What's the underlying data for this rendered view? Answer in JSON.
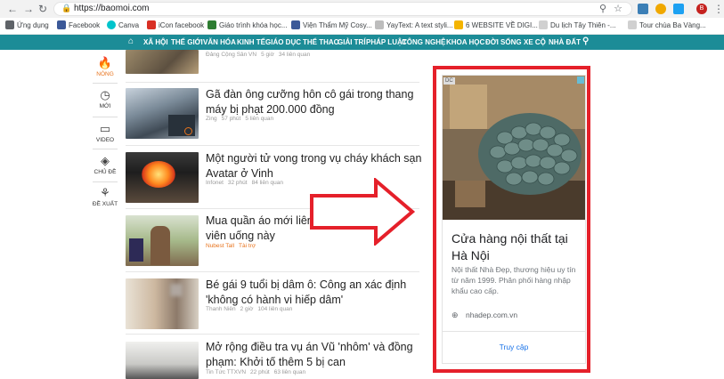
{
  "browser": {
    "url": "https://baomoi.com",
    "profile_initial": "B"
  },
  "bookmarks": [
    {
      "label": "Ứng dụng",
      "color": "#5f6368"
    },
    {
      "label": "Facebook",
      "color": "#3b5998"
    },
    {
      "label": "Canva",
      "color": "#00c4cc"
    },
    {
      "label": "iCon facebook",
      "color": "#d93025"
    },
    {
      "label": "Giáo trình khóa học...",
      "color": "#2e7d32"
    },
    {
      "label": "Viện Thẩm Mỹ Cosy...",
      "color": "#3b5998"
    },
    {
      "label": "YayText: A text styli...",
      "color": "#e0e0e0"
    },
    {
      "label": "6 WEBSITE VỀ DIGI...",
      "color": "#f4b400"
    },
    {
      "label": "Du lịch Tây Thiên -...",
      "color": "#e8e8e8"
    },
    {
      "label": "Tour chùa Ba Vàng...",
      "color": "#e8e8e8"
    }
  ],
  "site_nav": [
    "XÃ HỘI",
    "THẾ GIỚI",
    "VĂN HÓA",
    "KINH TẾ",
    "GIÁO DỤC",
    "THỂ THAO",
    "GIẢI TRÍ",
    "PHÁP LUẬT",
    "CÔNG NGHỆ",
    "KHOA HỌC",
    "ĐỜI SỐNG",
    "XE CỘ",
    "NHÀ ĐẤT"
  ],
  "rail": [
    {
      "label": "NÓNG",
      "icon": "flame-icon"
    },
    {
      "label": "MỚI",
      "icon": "clock-icon"
    },
    {
      "label": "VIDEO",
      "icon": "video-icon"
    },
    {
      "label": "CHỦ ĐỀ",
      "icon": "layers-icon"
    },
    {
      "label": "ĐỀ XUẤT",
      "icon": "award-icon"
    }
  ],
  "articles": [
    {
      "title": "",
      "meta": [
        "Đảng Cộng Sản VN",
        "5 giờ",
        "34 liên quan"
      ]
    },
    {
      "title": "Gã đàn ông cưỡng hôn cô gái trong thang máy bị phạt 200.000 đồng",
      "meta": [
        "Zing",
        "57 phút",
        "5 liên quan"
      ]
    },
    {
      "title": "Một người tử vong trong vụ cháy khách sạn Avatar ở Vinh",
      "meta": [
        "Infonet",
        "32 phút",
        "84 liên quan"
      ]
    },
    {
      "title": "Mua quần áo mới liên tụ... khi sử dụng viên uống này",
      "meta": [
        "Nubest Tall",
        "Tài trợ"
      ]
    },
    {
      "title": "Bé gái 9 tuổi bị dâm ô: Công an xác định 'không có hành vi hiếp dâm'",
      "meta": [
        "Thanh Niên",
        "2 giờ",
        "104 liên quan"
      ]
    },
    {
      "title": "Mở rộng điều tra vụ án Vũ 'nhôm' và đồng phạm: Khởi tố thêm 5 bị can",
      "meta": [
        "Tin Tức TTXVN",
        "22 phút",
        "63 liên quan"
      ]
    }
  ],
  "ad": {
    "badge": "DC",
    "title": "Cửa hàng nội thất tại Hà Nội",
    "description": "Nội thất Nhà Đẹp, thương hiệu uy tín từ năm 1999. Phân phối hàng nhập khẩu cao cấp.",
    "domain": "nhadep.com.vn",
    "cta": "Truy cập"
  },
  "colors": {
    "accent": "#1c8c97",
    "highlight": "#e5202a",
    "sponsor": "#e8731c"
  }
}
